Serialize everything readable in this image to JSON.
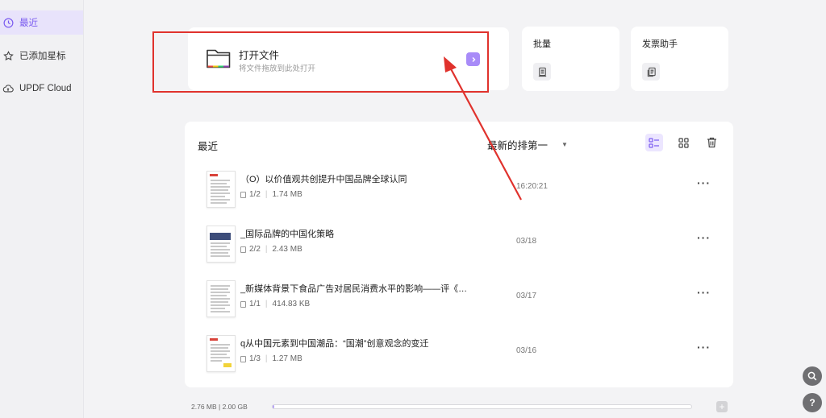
{
  "sidebar": {
    "items": [
      {
        "label": "最近",
        "icon": "clock-icon",
        "active": true
      },
      {
        "label": "已添加星标",
        "icon": "star-icon",
        "active": false
      },
      {
        "label": "UPDF Cloud",
        "icon": "cloud-icon",
        "active": false
      }
    ]
  },
  "open_file": {
    "title": "打开文件",
    "subtitle": "将文件拖放到此处打开",
    "icon": "folder-icon"
  },
  "tools": [
    {
      "label": "批量",
      "icon": "batch-icon"
    },
    {
      "label": "发票助手",
      "icon": "invoice-icon"
    }
  ],
  "recent": {
    "title": "最近",
    "sort_label": "最新的排第一",
    "files": [
      {
        "name": "（O）以价值观共创提升中国品牌全球认同",
        "pages": "1/2",
        "size": "1.74 MB",
        "date": "16:20:21"
      },
      {
        "name": "_国际品牌的中国化策略",
        "pages": "2/2",
        "size": "2.43 MB",
        "date": "03/18"
      },
      {
        "name": "_新媒体背景下食品广告对居民消费水平的影响——评《食品广…",
        "pages": "1/1",
        "size": "414.83 KB",
        "date": "03/17"
      },
      {
        "name": "q从中国元素到中国潮品：“国潮”创意观念的变迁",
        "pages": "1/3",
        "size": "1.27 MB",
        "date": "03/16"
      }
    ]
  },
  "storage": {
    "text": "2.76 MB | 2.00 GB",
    "used_fraction": 0.0013
  },
  "colors": {
    "accent": "#7b5cf0",
    "annotation": "#e0322d"
  }
}
